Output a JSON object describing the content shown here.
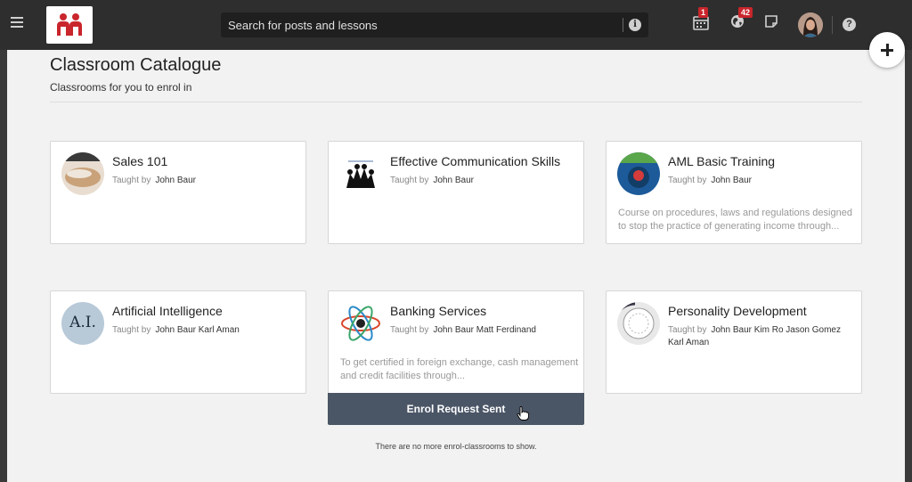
{
  "header": {
    "search_placeholder": "Search for posts and lessons",
    "calendar_badge": "1",
    "globe_badge": "42"
  },
  "icons": {
    "menu": "hamburger-icon",
    "logo": "brand-logo",
    "info": "info-icon",
    "calendar": "calendar-icon",
    "globe": "globe-icon",
    "notes": "note-icon",
    "help": "help-icon",
    "add": "plus-icon",
    "cursor": "hand-pointer-icon"
  },
  "colors": {
    "brand_red": "#c9252c",
    "topbar": "#2e2e2e",
    "enrol_button": "#4a5566"
  },
  "page": {
    "title": "Classroom Catalogue",
    "subtitle": "Classrooms for you to enrol in"
  },
  "classrooms": [
    {
      "title": "Sales 101",
      "taught_by_label": "Taught by",
      "teachers": "John Baur",
      "description": ""
    },
    {
      "title": "Effective Communication Skills",
      "taught_by_label": "Taught by",
      "teachers": "John Baur",
      "description": ""
    },
    {
      "title": "AML Basic Training",
      "taught_by_label": "Taught by",
      "teachers": "John Baur",
      "description": "Course on procedures, laws and regulations designed to stop the practice of generating income through..."
    },
    {
      "title": "Artificial Intelligence",
      "taught_by_label": "Taught by",
      "teachers": "John Baur Karl Aman",
      "description": "",
      "thumb_text": "A.I."
    },
    {
      "title": "Banking Services",
      "taught_by_label": "Taught by",
      "teachers": "John Baur Matt Ferdinand",
      "description": "To get certified in foreign exchange, cash management and credit facilities through..."
    },
    {
      "title": "Personality Development",
      "taught_by_label": "Taught by",
      "teachers": "John Baur Kim Ro Jason Gomez Karl Aman",
      "description": ""
    }
  ],
  "enrol_status": "Enrol Request Sent",
  "footer_message": "There are no more enrol-classrooms to show."
}
